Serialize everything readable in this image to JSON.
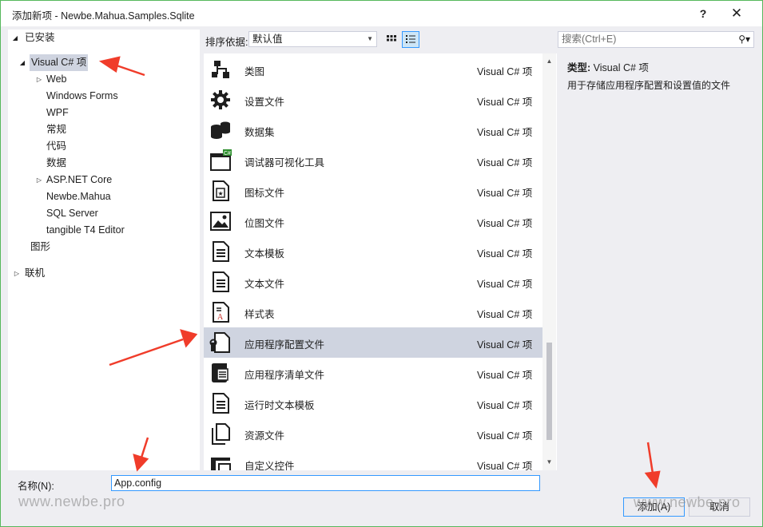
{
  "window": {
    "title": "添加新项 - Newbe.Mahua.Samples.Sqlite",
    "help_label": "?",
    "close_label": "✕"
  },
  "tree": {
    "installed_label": "已安装",
    "root_label": "Visual C# 项",
    "children": [
      {
        "label": "Web",
        "expandable": true
      },
      {
        "label": "Windows Forms",
        "expandable": false
      },
      {
        "label": "WPF",
        "expandable": false
      },
      {
        "label": "常规",
        "expandable": false
      },
      {
        "label": "代码",
        "expandable": false
      },
      {
        "label": "数据",
        "expandable": false
      },
      {
        "label": "ASP.NET Core",
        "expandable": true
      },
      {
        "label": "Newbe.Mahua",
        "expandable": false
      },
      {
        "label": "SQL Server",
        "expandable": false
      },
      {
        "label": "tangible T4 Editor",
        "expandable": false
      }
    ],
    "graphics_label": "图形",
    "online_label": "联机"
  },
  "toolbar": {
    "sort_label": "排序依据:",
    "sort_value": "默认值"
  },
  "items": [
    {
      "name": "类图",
      "type": "Visual C# 项",
      "icon": "class-diagram-icon"
    },
    {
      "name": "设置文件",
      "type": "Visual C# 项",
      "icon": "settings-gear-icon"
    },
    {
      "name": "数据集",
      "type": "Visual C# 项",
      "icon": "dataset-icon"
    },
    {
      "name": "调试器可视化工具",
      "type": "Visual C# 项",
      "icon": "debugger-visualizer-icon"
    },
    {
      "name": "图标文件",
      "type": "Visual C# 项",
      "icon": "icon-file-icon"
    },
    {
      "name": "位图文件",
      "type": "Visual C# 项",
      "icon": "bitmap-icon"
    },
    {
      "name": "文本模板",
      "type": "Visual C# 项",
      "icon": "text-template-icon"
    },
    {
      "name": "文本文件",
      "type": "Visual C# 项",
      "icon": "text-file-icon"
    },
    {
      "name": "样式表",
      "type": "Visual C# 项",
      "icon": "stylesheet-icon"
    },
    {
      "name": "应用程序配置文件",
      "type": "Visual C# 项",
      "icon": "app-config-icon",
      "selected": true
    },
    {
      "name": "应用程序清单文件",
      "type": "Visual C# 项",
      "icon": "manifest-icon"
    },
    {
      "name": "运行时文本模板",
      "type": "Visual C# 项",
      "icon": "runtime-template-icon"
    },
    {
      "name": "资源文件",
      "type": "Visual C# 项",
      "icon": "resource-file-icon"
    },
    {
      "name": "自定义控件",
      "type": "Visual C# 项",
      "icon": "custom-control-icon"
    }
  ],
  "search": {
    "placeholder": "搜索(Ctrl+E)"
  },
  "detail": {
    "type_label": "类型:",
    "type_value": "Visual C# 项",
    "description": "用于存储应用程序配置和设置值的文件"
  },
  "bottom": {
    "name_label": "名称(N):",
    "name_value": "App.config",
    "add_label": "添加(A)",
    "cancel_label": "取消"
  },
  "watermark": "www.newbe.pro",
  "annotation_color": "#f03c2a"
}
